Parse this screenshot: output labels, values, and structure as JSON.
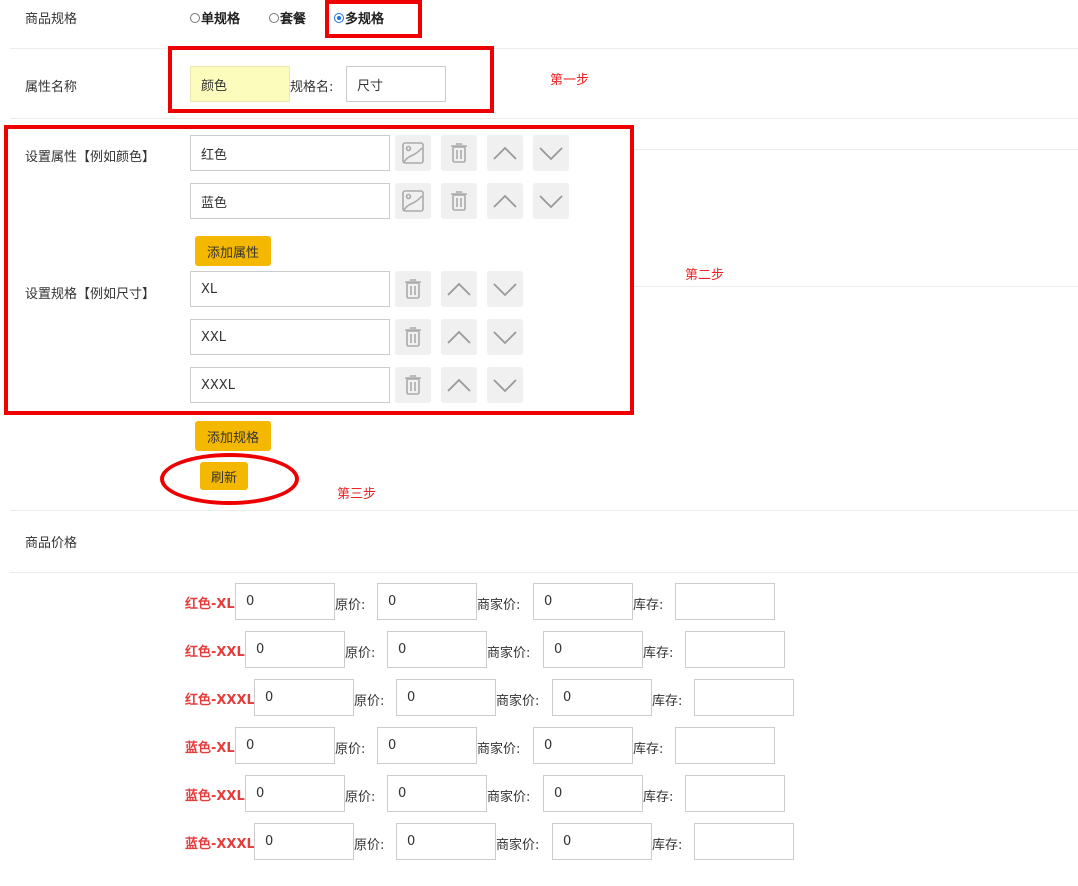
{
  "spec": {
    "label": "商品规格",
    "options": [
      {
        "label": "单规格",
        "selected": false
      },
      {
        "label": "套餐",
        "selected": false
      },
      {
        "label": "多规格",
        "selected": true
      }
    ]
  },
  "attr_name": {
    "label": "属性名称",
    "value": "颜色",
    "spec_label": "规格名:",
    "spec_value": "尺寸"
  },
  "attributes": {
    "label": "设置属性【例如颜色】",
    "items": [
      "红色",
      "蓝色"
    ],
    "add_label": "添加属性"
  },
  "specs": {
    "label": "设置规格【例如尺寸】",
    "items": [
      "XL",
      "XXL",
      "XXXL"
    ],
    "add_label": "添加规格"
  },
  "refresh_label": "刷新",
  "annotations": {
    "step1": "第一步",
    "step2": "第二步",
    "step3": "第三步"
  },
  "price": {
    "label": "商品价格",
    "col_original": "原价:",
    "col_merchant": "商家价:",
    "col_stock": "库存:",
    "rows": [
      {
        "name": "红色-XL",
        "price": "0",
        "original": "0",
        "merchant": "0",
        "stock": ""
      },
      {
        "name": "红色-XXL",
        "price": "0",
        "original": "0",
        "merchant": "0",
        "stock": ""
      },
      {
        "name": "红色-XXXL",
        "price": "0",
        "original": "0",
        "merchant": "0",
        "stock": ""
      },
      {
        "name": "蓝色-XL",
        "price": "0",
        "original": "0",
        "merchant": "0",
        "stock": ""
      },
      {
        "name": "蓝色-XXL",
        "price": "0",
        "original": "0",
        "merchant": "0",
        "stock": ""
      },
      {
        "name": "蓝色-XXXL",
        "price": "0",
        "original": "0",
        "merchant": "0",
        "stock": ""
      }
    ]
  },
  "colors": {
    "accent_button": "#f5b800",
    "annotation": "#ee0000",
    "sku_name": "#e63c3c",
    "highlight_input": "#fcfcbd"
  }
}
